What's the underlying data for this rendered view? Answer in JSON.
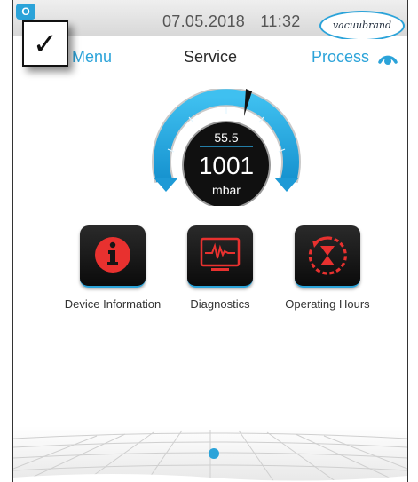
{
  "status_bar": {
    "app_badge": "O",
    "date": "07.05.2018",
    "time": "11:32",
    "brand": "vacuubrand"
  },
  "nav": {
    "back_label": "Menu",
    "title": "Service",
    "process_label": "Process"
  },
  "checkbox": {
    "glyph": "✓"
  },
  "gauge": {
    "setpoint": "55.5",
    "value": "1001",
    "unit": "mbar"
  },
  "tiles": [
    {
      "label": "Device Information",
      "icon": "info-icon"
    },
    {
      "label": "Diagnostics",
      "icon": "diagnostics-monitor-icon"
    },
    {
      "label": "Operating Hours",
      "icon": "hourglass-clock-icon"
    }
  ],
  "pager": {
    "pages": 1,
    "current": 1
  },
  "colors": {
    "accent": "#2ba3d9",
    "icon_red": "#e8312f",
    "tile_bg": "#151515",
    "gauge_inner": "#101010"
  }
}
